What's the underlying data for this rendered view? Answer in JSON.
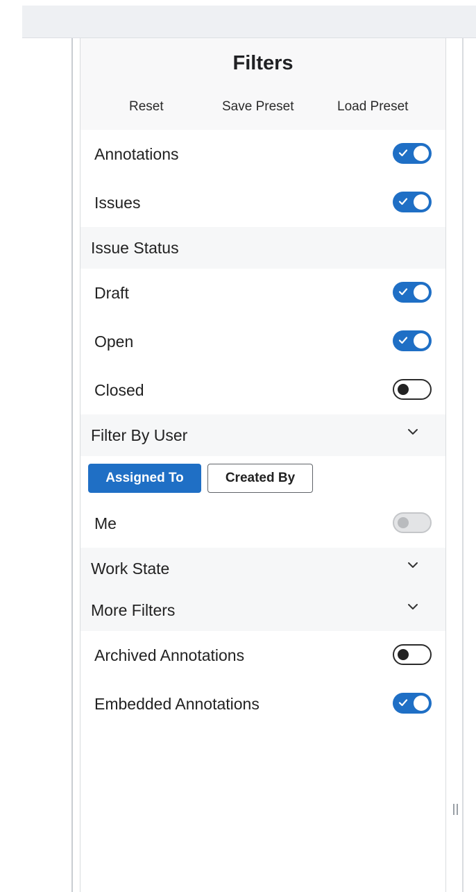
{
  "filters_panel": {
    "title": "Filters",
    "actions": {
      "reset": "Reset",
      "save_preset": "Save Preset",
      "load_preset": "Load Preset"
    },
    "annotations": {
      "label": "Annotations",
      "enabled": true
    },
    "issues": {
      "label": "Issues",
      "enabled": true
    },
    "issue_status": {
      "label": "Issue Status",
      "draft": {
        "label": "Draft",
        "enabled": true
      },
      "open": {
        "label": "Open",
        "enabled": true
      },
      "closed": {
        "label": "Closed",
        "enabled": false
      }
    },
    "filter_by_user": {
      "label": "Filter By User",
      "expand_icon": "chevron-down-icon",
      "tabs": {
        "assigned_to": "Assigned To",
        "created_by": "Created By"
      },
      "selected_tab": "Assigned To",
      "me": {
        "label": "Me",
        "enabled": false,
        "disabled": true
      }
    },
    "work_state": {
      "label": "Work State",
      "expand_icon": "chevron-down-icon"
    },
    "more_filters": {
      "label": "More Filters",
      "expand_icon": "chevron-down-icon"
    },
    "archived_annotations": {
      "label": "Archived Annotations",
      "enabled": false
    },
    "embedded_annotations": {
      "label": "Embedded Annotations",
      "enabled": true
    }
  },
  "colors": {
    "accent": "#1f6fc5",
    "header_bg": "#f8f8f9",
    "section_bg": "#f6f7f8",
    "topbar_bg": "#eef0f3"
  }
}
